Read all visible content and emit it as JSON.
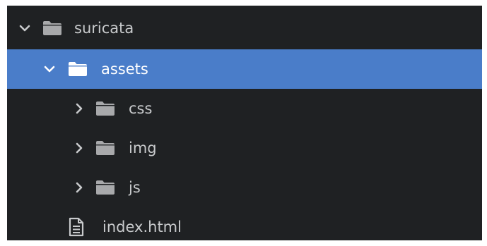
{
  "tree": {
    "items": [
      {
        "label": "suricata",
        "kind": "folder",
        "expanded": true,
        "selected": false,
        "depth": 0
      },
      {
        "label": "assets",
        "kind": "folder",
        "expanded": true,
        "selected": true,
        "depth": 1
      },
      {
        "label": "css",
        "kind": "folder",
        "expanded": false,
        "selected": false,
        "depth": 2
      },
      {
        "label": "img",
        "kind": "folder",
        "expanded": false,
        "selected": false,
        "depth": 2
      },
      {
        "label": "js",
        "kind": "folder",
        "expanded": false,
        "selected": false,
        "depth": 2
      },
      {
        "label": "index.html",
        "kind": "file",
        "selected": false,
        "depth": 1
      }
    ]
  },
  "colors": {
    "background": "#1f2123",
    "selection": "#4a7dc9",
    "text": "#c8cacc",
    "selected_text": "#ffffff",
    "folder": "#a8a9ab",
    "selected_folder": "#ffffff"
  }
}
